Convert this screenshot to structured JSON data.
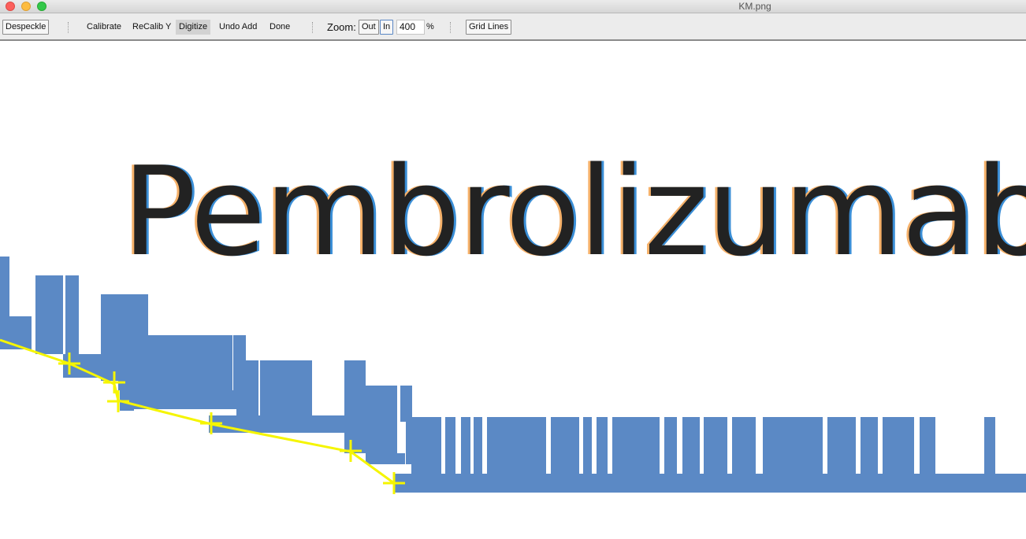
{
  "window": {
    "title": "KM.png"
  },
  "toolbar": {
    "despeckle": "Despeckle",
    "calibrate": "Calibrate",
    "recalib_y": "ReCalib Y",
    "digitize": "Digitize",
    "undo_add": "Undo Add",
    "done": "Done",
    "zoom_label": "Zoom:",
    "zoom_out": "Out",
    "zoom_in": "In",
    "zoom_value": "400",
    "zoom_unit": "%",
    "grid_lines": "Grid Lines"
  },
  "image": {
    "label": "Pembrolizumab",
    "curve_color": "#5b89c5",
    "marker_color": "#f5f500",
    "text_color": "#222222"
  }
}
